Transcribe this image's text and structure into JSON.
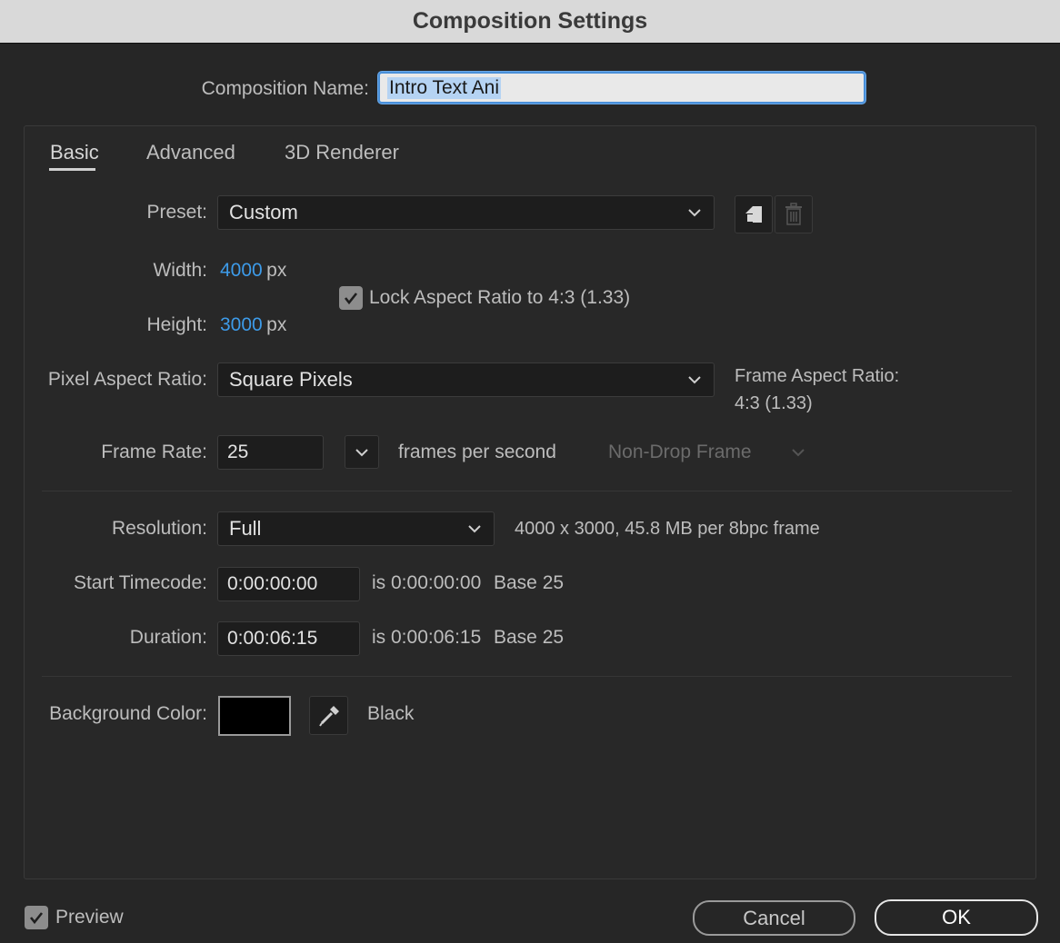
{
  "title": "Composition Settings",
  "composition_name": {
    "label": "Composition Name:",
    "value": "Intro Text Ani"
  },
  "tabs": [
    "Basic",
    "Advanced",
    "3D Renderer"
  ],
  "preset": {
    "label": "Preset:",
    "value": "Custom",
    "save_icon": "save-preset-icon",
    "delete_icon": "trash-icon"
  },
  "width": {
    "label": "Width:",
    "value": "4000",
    "unit": "px"
  },
  "height": {
    "label": "Height:",
    "value": "3000",
    "unit": "px"
  },
  "lock_aspect": {
    "label": "Lock Aspect Ratio to 4:3 (1.33)",
    "checked": true
  },
  "pixel_aspect": {
    "label": "Pixel Aspect Ratio:",
    "value": "Square Pixels"
  },
  "frame_aspect": {
    "label": "Frame Aspect Ratio:",
    "value": "4:3 (1.33)"
  },
  "frame_rate": {
    "label": "Frame Rate:",
    "value": "25",
    "unit_label": "frames per second",
    "drop_frame": "Non-Drop Frame"
  },
  "resolution": {
    "label": "Resolution:",
    "value": "Full",
    "info": "4000 x 3000, 45.8 MB per 8bpc frame"
  },
  "start_timecode": {
    "label": "Start Timecode:",
    "value": "0:00:00:00",
    "is_text": "is 0:00:00:00",
    "base": "Base 25"
  },
  "duration": {
    "label": "Duration:",
    "value": "0:00:06:15",
    "is_text": "is 0:00:06:15",
    "base": "Base 25"
  },
  "background_color": {
    "label": "Background Color:",
    "color": "#000000",
    "name": "Black",
    "eyedropper_icon": "eyedropper-icon"
  },
  "footer": {
    "preview_label": "Preview",
    "preview_checked": true,
    "cancel": "Cancel",
    "ok": "OK"
  },
  "colors": {
    "accent_blue": "#3d9be9",
    "focus_ring": "#4a90d9",
    "background": "#262626"
  }
}
